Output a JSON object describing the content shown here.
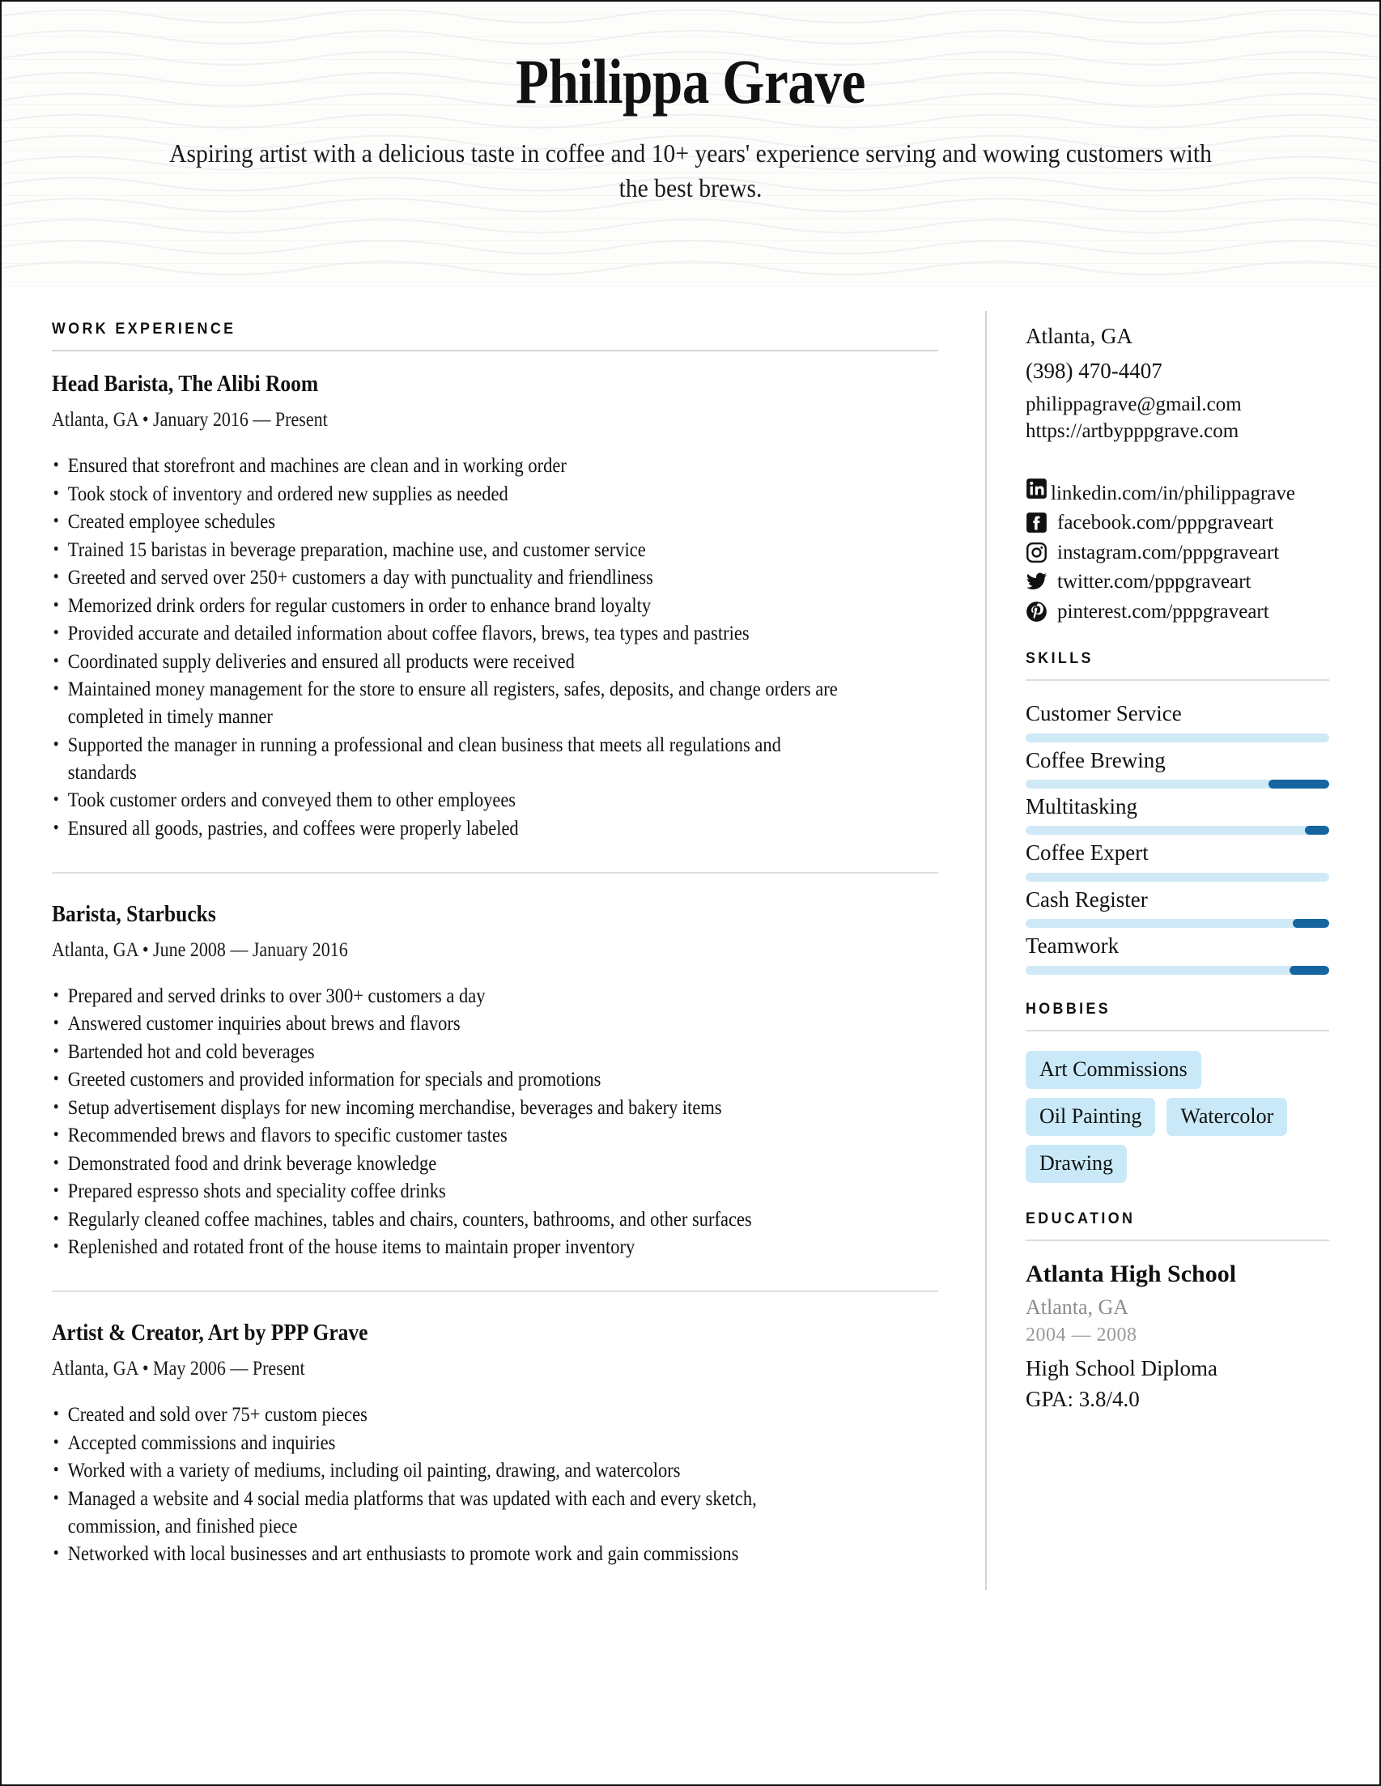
{
  "header": {
    "name": "Philippa Grave",
    "tagline": "Aspiring artist with a delicious taste in coffee and 10+ years' experience serving and wowing customers with the best brews."
  },
  "sections": {
    "work_experience": "WORK EXPERIENCE",
    "skills": "SKILLS",
    "hobbies": "HOBBIES",
    "education": "EDUCATION"
  },
  "jobs": [
    {
      "title": "Head Barista, The Alibi Room",
      "meta": "Atlanta, GA • January 2016 — Present",
      "bullets": [
        "Ensured that storefront and machines are clean and in working order",
        "Took stock of inventory and ordered new supplies as needed",
        "Created employee schedules",
        "Trained 15 baristas in beverage preparation, machine use, and customer service",
        "Greeted and served over 250+ customers a day with punctuality and friendliness",
        "Memorized drink orders for regular customers in order to enhance brand loyalty",
        "Provided accurate and detailed information about coffee flavors, brews, tea types and pastries",
        "Coordinated supply deliveries and ensured all products were received",
        "Maintained money management for the store to ensure all registers, safes, deposits, and change orders are completed in timely manner",
        "Supported the manager in running a professional and clean business that meets all regulations and standards",
        "Took customer orders and conveyed them to other employees",
        "Ensured all goods, pastries, and coffees were properly labeled"
      ]
    },
    {
      "title": "Barista, Starbucks",
      "meta": "Atlanta, GA • June 2008 — January 2016",
      "bullets": [
        "Prepared and served drinks to over 300+ customers a day",
        "Answered customer inquiries about brews and flavors",
        "Bartended hot and cold beverages",
        "Greeted customers and provided information for specials and promotions",
        "Setup advertisement displays for new incoming merchandise, beverages and bakery items",
        "Recommended brews and flavors to specific customer tastes",
        "Demonstrated food and drink beverage knowledge",
        "Prepared espresso shots and speciality coffee drinks",
        "Regularly cleaned coffee machines, tables and chairs, counters, bathrooms, and other surfaces",
        "Replenished and rotated front of the house items to maintain proper inventory"
      ]
    },
    {
      "title": "Artist & Creator, Art by PPP Grave",
      "meta": "Atlanta, GA • May 2006 — Present",
      "bullets": [
        "Created and sold over 75+ custom pieces",
        "Accepted commissions and inquiries",
        "Worked with a variety of mediums, including oil painting, drawing, and watercolors",
        "Managed a website and 4 social media platforms that was updated with each and every sketch, commission, and finished piece",
        "Networked with local businesses and art enthusiasts to promote work and gain commissions"
      ]
    }
  ],
  "contact": {
    "location": "Atlanta, GA",
    "phone": "(398) 470-4407",
    "email": "philippagrave@gmail.com",
    "website": "https://artbypppgrave.com"
  },
  "social": [
    {
      "icon": "linkedin-icon",
      "text": "linkedin.com/in/philippagrave"
    },
    {
      "icon": "facebook-icon",
      "text": "facebook.com/pppgraveart"
    },
    {
      "icon": "instagram-icon",
      "text": "instagram.com/pppgraveart"
    },
    {
      "icon": "twitter-icon",
      "text": "twitter.com/pppgraveart"
    },
    {
      "icon": "pinterest-icon",
      "text": "pinterest.com/pppgraveart"
    }
  ],
  "skills": [
    {
      "name": "Customer Service",
      "level": 0
    },
    {
      "name": "Coffee Brewing",
      "level": 20
    },
    {
      "name": "Multitasking",
      "level": 8
    },
    {
      "name": "Coffee Expert",
      "level": 0
    },
    {
      "name": "Cash Register",
      "level": 12
    },
    {
      "name": "Teamwork",
      "level": 13
    }
  ],
  "hobbies": [
    "Art Commissions",
    "Oil Painting",
    "Watercolor",
    "Drawing"
  ],
  "education": {
    "school": "Atlanta High School",
    "location": "Atlanta, GA",
    "dates": "2004 — 2008",
    "degree": "High School Diploma",
    "gpa": "GPA: 3.8/4.0"
  },
  "colors": {
    "accent_dark": "#1565a0",
    "accent_light": "#cfe9f7",
    "tag_bg": "#c9e9f8",
    "rule": "#d4d4d4",
    "muted_text": "#8c8c8c"
  }
}
